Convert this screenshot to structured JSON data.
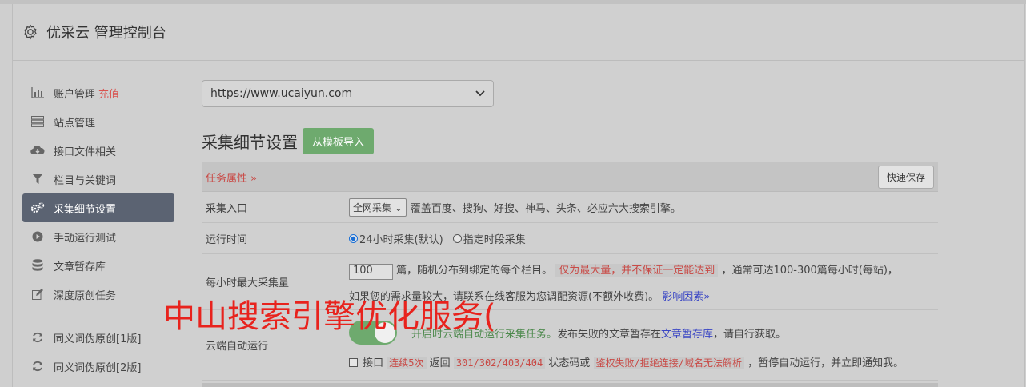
{
  "header": {
    "title": "优采云 管理控制台",
    "icon": "gear-icon"
  },
  "sidebar": {
    "items": [
      {
        "label": "账户管理",
        "badge": "充值",
        "icon": "bar-chart-icon"
      },
      {
        "label": "站点管理",
        "icon": "server-icon"
      },
      {
        "label": "接口文件相关",
        "icon": "cloud-download-icon"
      },
      {
        "label": "栏目与关键词",
        "icon": "filter-icon"
      },
      {
        "label": "采集细节设置",
        "icon": "gears-icon",
        "active": true
      },
      {
        "label": "手动运行测试",
        "icon": "play-circle-icon"
      },
      {
        "label": "文章暂存库",
        "icon": "database-icon"
      },
      {
        "label": "深度原创任务",
        "icon": "edit-icon"
      },
      {
        "label": "同义词伪原创[1版]",
        "icon": "refresh-icon"
      },
      {
        "label": "同义词伪原创[2版]",
        "icon": "refresh-icon"
      }
    ]
  },
  "main": {
    "site_select": "https://www.ucaiyun.com",
    "section_title": "采集细节设置",
    "import_button": "从模板导入",
    "task_bar": {
      "title": "任务属性 »",
      "save_button": "快速保存"
    },
    "rows": {
      "entry": {
        "label": "采集入口",
        "select": "全网采集",
        "desc": "覆盖百度、搜狗、好搜、神马、头条、必应六大搜索引擎。"
      },
      "runtime": {
        "label": "运行时间",
        "opt1": "24小时采集(默认)",
        "opt2": "指定时段采集"
      },
      "maxcount": {
        "label": "每小时最大采集量",
        "value": "100",
        "text1": "篇，随机分布到绑定的每个栏目。",
        "hl": "仅为最大量，并不保证一定能达到",
        "text2": "，通常可达100-300篇每小时(每站)，",
        "text3": "如果您的需求量较大，请联系在线客服为您调配资源(不额外收费)。",
        "link": "影响因素»"
      },
      "cloud": {
        "label": "云端自动运行",
        "green": "开启时云端自动运行采集任务。",
        "text1": "发布失败的文章暂存在",
        "link": "文章暂存库",
        "text2": "，请自行获取。",
        "check_label": "接口",
        "hl1": "连续5次",
        "text3": "返回",
        "code": "301/302/403/404",
        "text4": "状态码或",
        "hl2": "鉴权失败/拒绝连接/域名无法解析",
        "text5": "，暂停自动运行，并立即通知我。"
      }
    }
  },
  "overlay_text": "中山搜索引擎优化服务("
}
